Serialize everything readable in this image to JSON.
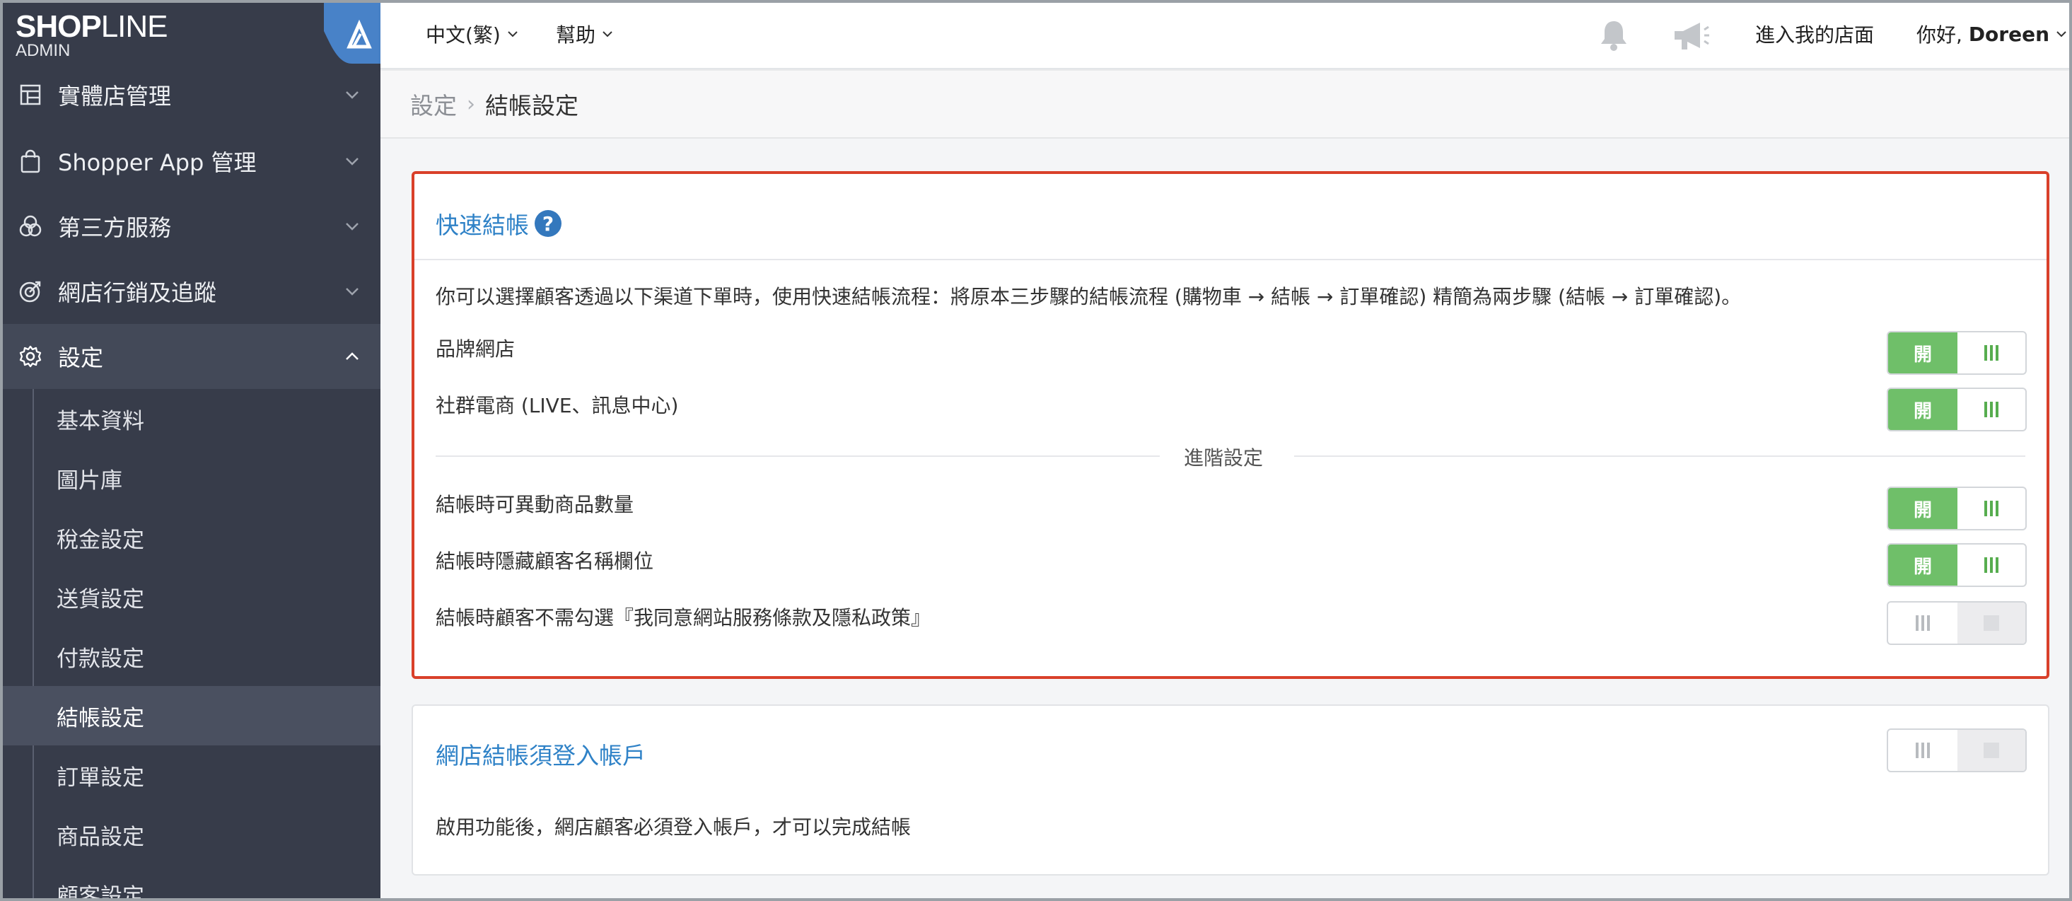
{
  "brand": {
    "logo_bold": "SHOP",
    "logo_thin": "LINE",
    "subtitle": "ADMIN"
  },
  "sidebar": {
    "items": [
      {
        "label": "實體店管理",
        "icon": "store-icon"
      },
      {
        "label": "Shopper App 管理",
        "icon": "shopping-bag-icon"
      },
      {
        "label": "第三方服務",
        "icon": "circles-icon"
      },
      {
        "label": "網店行銷及追蹤",
        "icon": "target-icon"
      },
      {
        "label": "設定",
        "icon": "gear-icon"
      }
    ],
    "sub_items": [
      "基本資料",
      "圖片庫",
      "稅金設定",
      "送貨設定",
      "付款設定",
      "結帳設定",
      "訂單設定",
      "商品設定",
      "顧客設定"
    ]
  },
  "topbar": {
    "language": "中文(繁)",
    "help": "幫助",
    "store_link": "進入我的店面",
    "greeting": "你好, ",
    "username": "Doreen"
  },
  "breadcrumb": {
    "parent": "設定",
    "current": "結帳設定"
  },
  "express_checkout": {
    "title": "快速結帳",
    "help_icon": "?",
    "description": "你可以選擇顧客透過以下渠道下單時，使用快速結帳流程：將原本三步驟的結帳流程 (購物車 → 結帳 → 訂單確認) 精簡為兩步驟 (結帳 → 訂單確認)。",
    "advanced_label": "進階設定",
    "rows": [
      {
        "label": "品牌網店",
        "on": true
      },
      {
        "label": "社群電商 (LIVE、訊息中心)",
        "on": true
      },
      {
        "label": "結帳時可異動商品數量",
        "on": true
      },
      {
        "label": "結帳時隱藏顧客名稱欄位",
        "on": true
      },
      {
        "label": "結帳時顧客不需勾選『我同意網站服務條款及隱私政策』",
        "on": false
      }
    ],
    "toggle_on_label": "開"
  },
  "login_required": {
    "title": "網店結帳須登入帳戶",
    "description": "啟用功能後，網店顧客必須登入帳戶，才可以完成結帳",
    "on": false
  },
  "colors": {
    "sidebar_bg": "#373c4a",
    "accent_blue": "#2f82c7",
    "toggle_green": "#6fbf69",
    "highlight_red": "#d9402a"
  }
}
